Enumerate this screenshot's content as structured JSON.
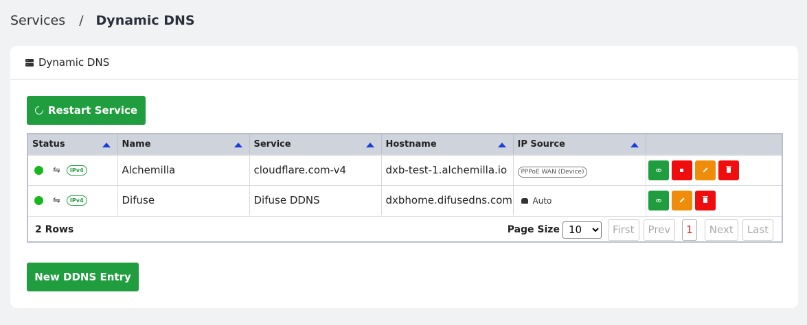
{
  "breadcrumb": {
    "parent": "Services",
    "separator": "/",
    "current": "Dynamic DNS"
  },
  "card": {
    "title": "Dynamic DNS",
    "title_icon": "server-icon"
  },
  "restart_button": {
    "label": "Restart Service",
    "icon": "refresh-icon"
  },
  "table": {
    "columns": [
      "Status",
      "Name",
      "Service",
      "Hostname",
      "IP Source"
    ],
    "rows": [
      {
        "status": "online",
        "ip_version": "IPv4",
        "name": "Alchemilla",
        "service": "cloudflare.com-v4",
        "hostname": "dxb-test-1.alchemilla.io",
        "ip_source": "PPPoE WAN (Device)",
        "ip_source_kind": "pill",
        "actions": [
          "view",
          "stop",
          "edit",
          "delete"
        ]
      },
      {
        "status": "online",
        "ip_version": "IPv4",
        "name": "Difuse",
        "service": "Difuse DDNS",
        "hostname": "dxbhome.difusedns.com",
        "ip_source": "Auto",
        "ip_source_kind": "auto",
        "actions": [
          "view",
          "edit",
          "delete"
        ]
      }
    ],
    "footer": {
      "rows_count": "2 Rows",
      "page_size_label": "Page Size",
      "page_size": "10",
      "first": "First",
      "prev": "Prev",
      "current_page": "1",
      "next": "Next",
      "last": "Last"
    }
  },
  "new_button": {
    "label": "New DDNS Entry"
  },
  "colors": {
    "primary_green": "#1f9d3f",
    "danger_red": "#f00d0d",
    "warning_orange": "#ef8d0b",
    "status_online": "#17b81c",
    "sort_arrow": "#1a3fd6"
  }
}
